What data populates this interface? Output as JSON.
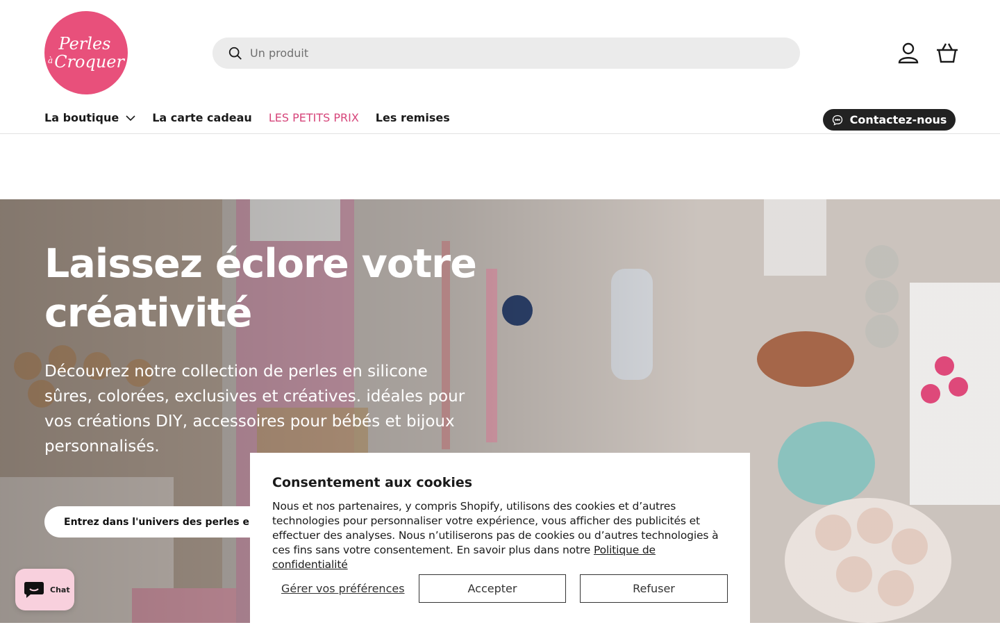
{
  "brand": {
    "logo_line1": "Perles",
    "logo_small": "à",
    "logo_line2": "Croquer",
    "color": "#e8507b"
  },
  "search": {
    "placeholder": "Un produit",
    "icon": "search-icon"
  },
  "header_icons": {
    "account": "user-icon",
    "cart": "basket-icon"
  },
  "nav": {
    "items": [
      {
        "label": "La boutique",
        "has_dropdown": true
      },
      {
        "label": "La carte cadeau"
      },
      {
        "label": "LES PETITS PRIX",
        "highlight_color": "#d6457a"
      },
      {
        "label": "Les remises"
      }
    ],
    "contact_label": "Contactez-nous"
  },
  "hero": {
    "title_line1": "Laissez éclore votre",
    "title_line2": "créativité",
    "subtitle": "Découvrez notre collection de perles en silicone sûres, colorées, exclusives et créatives. idéales pour vos créations DIY, accessoires pour bébés et bijoux personnalisés.",
    "cta": "Entrez dans l'univers des perles en silicone"
  },
  "cookie": {
    "title": "Consentement aux cookies",
    "text": "Nous et nos partenaires, y compris Shopify, utilisons des cookies et d’autres technologies pour personnaliser votre expérience, vous afficher des publicités et effectuer des analyses. Nous n’utiliserons pas de cookies ou d’autres technologies à ces fins sans votre consentement. En savoir plus dans notre",
    "link": "Politique de confidentialité",
    "preferences": "Gérer vos préférences",
    "accept": "Accepter",
    "refuse": "Refuser"
  },
  "chat": {
    "label": "Chat",
    "color": "#f8d0dd"
  }
}
